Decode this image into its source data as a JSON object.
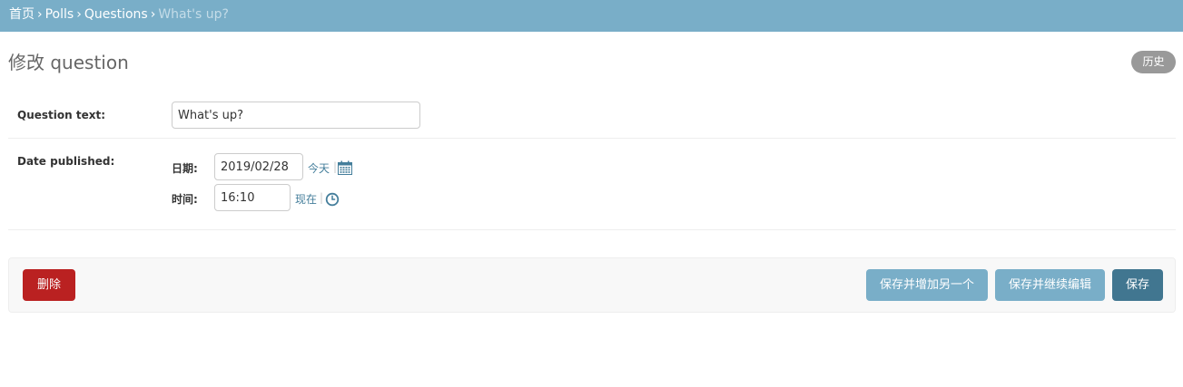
{
  "breadcrumbs": {
    "home": "首页",
    "app": "Polls",
    "model": "Questions",
    "current": "What's up?",
    "separator": "›"
  },
  "page": {
    "title": "修改 question",
    "history_label": "历史"
  },
  "form": {
    "question_text": {
      "label": "Question text:",
      "value": "What's up?"
    },
    "date_published": {
      "label": "Date published:",
      "date_label": "日期:",
      "date_value": "2019/02/28",
      "today_link": "今天",
      "time_label": "时间:",
      "time_value": "16:10",
      "now_link": "现在",
      "pipe": "|"
    }
  },
  "actions": {
    "delete": "删除",
    "save_add_another": "保存并增加另一个",
    "save_continue": "保存并继续编辑",
    "save": "保存"
  },
  "icons": {
    "calendar": "calendar-icon",
    "clock": "clock-icon"
  },
  "colors": {
    "header": "#79aec8",
    "link": "#447e9b",
    "delete": "#ba2121",
    "primary": "#417690",
    "secondary": "#79aec8"
  }
}
